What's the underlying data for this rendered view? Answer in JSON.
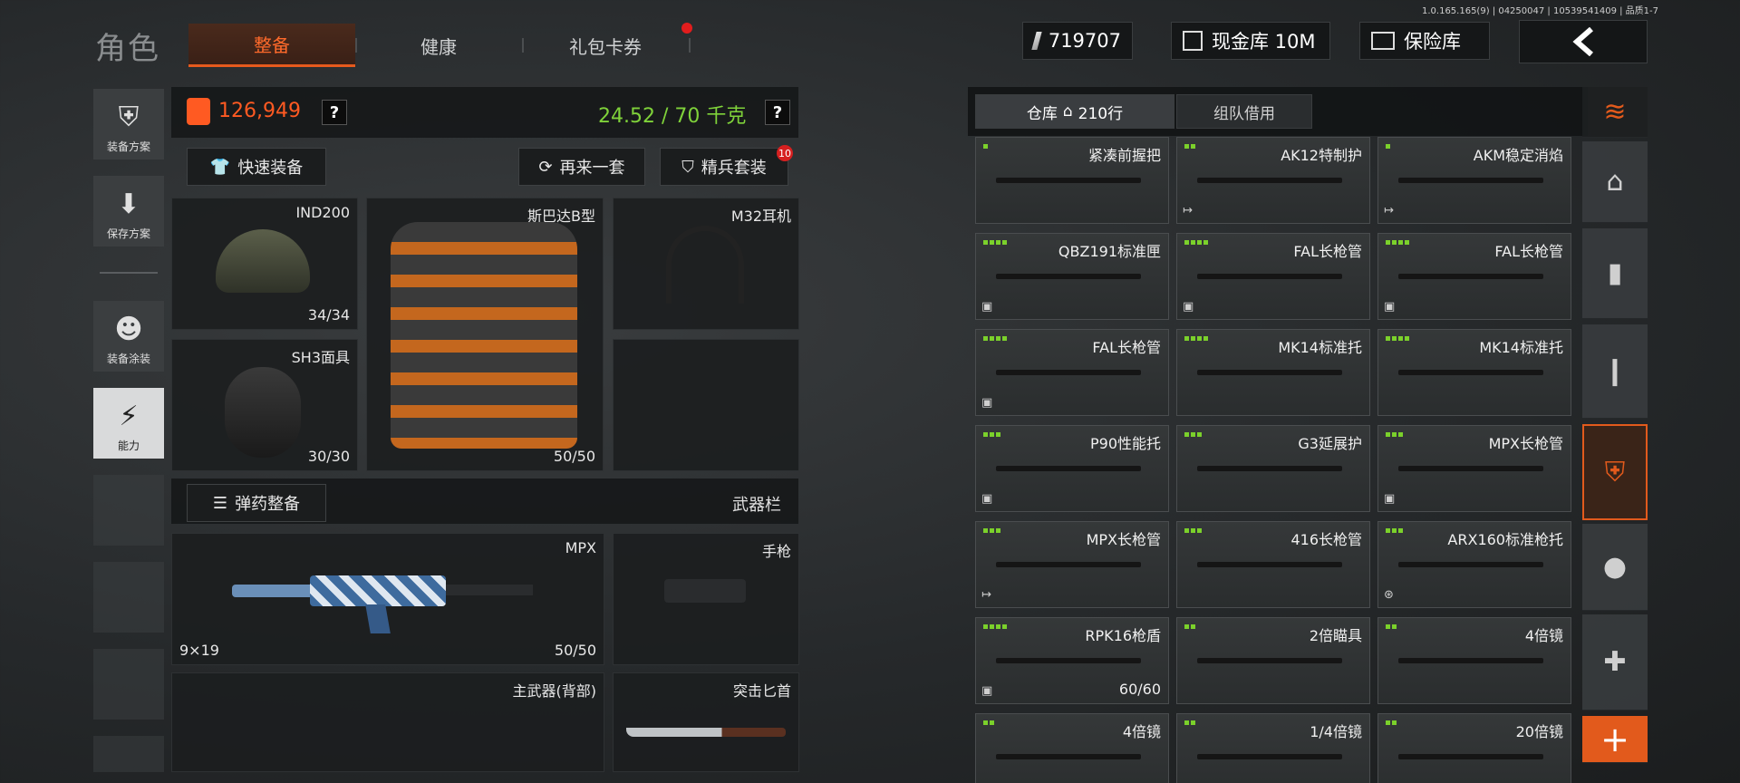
{
  "version_text": "1.0.165.165(9) | 04250047 | 10539541409 | 品质1-7",
  "header": {
    "title": "角色",
    "tabs": [
      {
        "label": "整备",
        "active": true
      },
      {
        "label": "健康",
        "active": false
      },
      {
        "label": "礼包卡券",
        "active": false
      }
    ],
    "currency": "719707",
    "cash_vault": "现金库 10M",
    "insurance": "保险库"
  },
  "left_menu": [
    {
      "label": "装备方案",
      "icon": "vest-icon"
    },
    {
      "label": "保存方案",
      "icon": "download-icon"
    },
    {
      "label": "装备涂装",
      "icon": "character-icon"
    },
    {
      "label": "能力",
      "icon": "lightning-icon",
      "active": true
    }
  ],
  "loadout": {
    "value": "126,949",
    "weight": "24.52 / 70 千克",
    "help": "?",
    "quick_equip": "快速装备",
    "reroll": "再来一套",
    "elite": "精兵套装",
    "elite_badge": "10",
    "slots": {
      "helmet": {
        "name": "IND200",
        "durability": "34/34"
      },
      "armor": {
        "name": "斯巴达B型",
        "durability": "50/50"
      },
      "headset": {
        "name": "M32耳机"
      },
      "mask": {
        "name": "SH3面具",
        "durability": "30/30"
      }
    },
    "ammo_button": "弹药整备",
    "weapon_bar": "武器栏",
    "primary": {
      "name": "MPX",
      "caliber": "9×19",
      "durability": "50/50"
    },
    "pistol": {
      "name": "手枪"
    },
    "primary_back": {
      "name": "主武器(背部)"
    },
    "melee": {
      "name": "突击匕首"
    }
  },
  "warehouse": {
    "tab_storage": "仓库",
    "tab_storage_count": "210行",
    "tab_team": "组队借用",
    "items": [
      {
        "name": "紧凑前握把",
        "dots": 1,
        "icon": ""
      },
      {
        "name": "AK12特制护",
        "dots": 2,
        "icon": "↦"
      },
      {
        "name": "AKM稳定消焰",
        "dots": 1,
        "icon": "↦"
      },
      {
        "name": "QBZ191标准匣",
        "dots": 4,
        "icon": "▣"
      },
      {
        "name": "FAL长枪管",
        "dots": 4,
        "icon": "▣"
      },
      {
        "name": "FAL长枪管",
        "dots": 4,
        "icon": "▣"
      },
      {
        "name": "FAL长枪管",
        "dots": 4,
        "icon": "▣"
      },
      {
        "name": "MK14标准托",
        "dots": 4,
        "icon": ""
      },
      {
        "name": "MK14标准托",
        "dots": 4,
        "icon": ""
      },
      {
        "name": "P90性能托",
        "dots": 3,
        "icon": "▣"
      },
      {
        "name": "G3延展护",
        "dots": 3,
        "icon": ""
      },
      {
        "name": "MPX长枪管",
        "dots": 3,
        "icon": "▣"
      },
      {
        "name": "MPX长枪管",
        "dots": 3,
        "icon": "↦"
      },
      {
        "name": "416长枪管",
        "dots": 3,
        "icon": ""
      },
      {
        "name": "ARX160标准枪托",
        "dots": 3,
        "icon": "⊛"
      },
      {
        "name": "RPK16枪盾",
        "dots": 4,
        "icon": "▣",
        "durability": "60/60"
      },
      {
        "name": "2倍瞄具",
        "dots": 2,
        "icon": ""
      },
      {
        "name": "4倍镜",
        "dots": 2,
        "icon": ""
      },
      {
        "name": "4倍镜",
        "dots": 2,
        "icon": ""
      },
      {
        "name": "1/4倍镜",
        "dots": 2,
        "icon": ""
      },
      {
        "name": "20倍镜",
        "dots": 2,
        "icon": ""
      }
    ]
  },
  "categories": [
    {
      "icon": "layers-icon",
      "glyph": "≋"
    },
    {
      "icon": "home-icon",
      "glyph": "⌂"
    },
    {
      "icon": "magazine-icon",
      "glyph": "▮"
    },
    {
      "icon": "ammo-icon",
      "glyph": "❙"
    },
    {
      "icon": "gear-vest-icon",
      "glyph": "⛨",
      "active": true
    },
    {
      "icon": "grenade-icon",
      "glyph": "●"
    },
    {
      "icon": "medkit-icon",
      "glyph": "✚"
    },
    {
      "icon": "add-icon",
      "glyph": "+"
    }
  ],
  "colors": {
    "accent": "#e65a1d",
    "money": "#ff5a22",
    "weight": "#7fd23a"
  }
}
